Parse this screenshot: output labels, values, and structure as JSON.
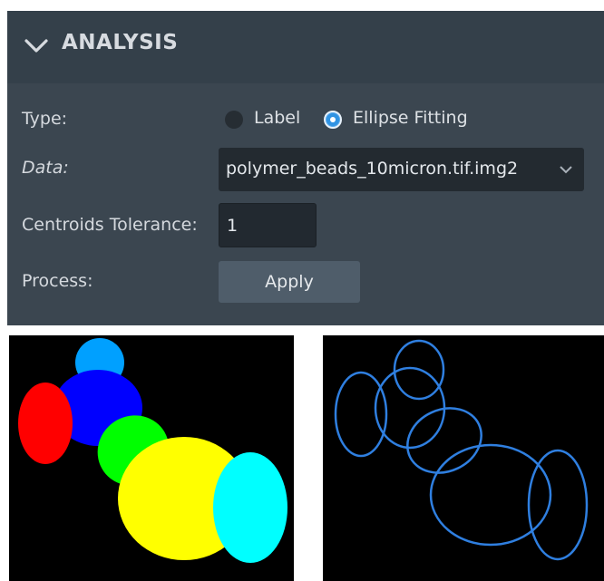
{
  "analysis": {
    "title": "ANALYSIS",
    "type_label": "Type:",
    "type_options": [
      {
        "label": "Label",
        "selected": false
      },
      {
        "label": "Ellipse Fitting",
        "selected": true
      }
    ],
    "data_label": "Data:",
    "data_value": "polymer_beads_10micron.tif.img2",
    "tolerance_label": "Centroids Tolerance:",
    "tolerance_value": "1",
    "process_label": "Process:",
    "apply_label": "Apply"
  },
  "views": {
    "label_view": {
      "colors": [
        "#00a0ff",
        "#0000ff",
        "#ff0000",
        "#00ff00",
        "#ffff00",
        "#00ffff"
      ]
    },
    "ellipse_view": {
      "outline_color": "#2f7fe0"
    }
  },
  "icons": {
    "collapse": "chevron-down-icon",
    "combo": "chevron-down-icon"
  }
}
